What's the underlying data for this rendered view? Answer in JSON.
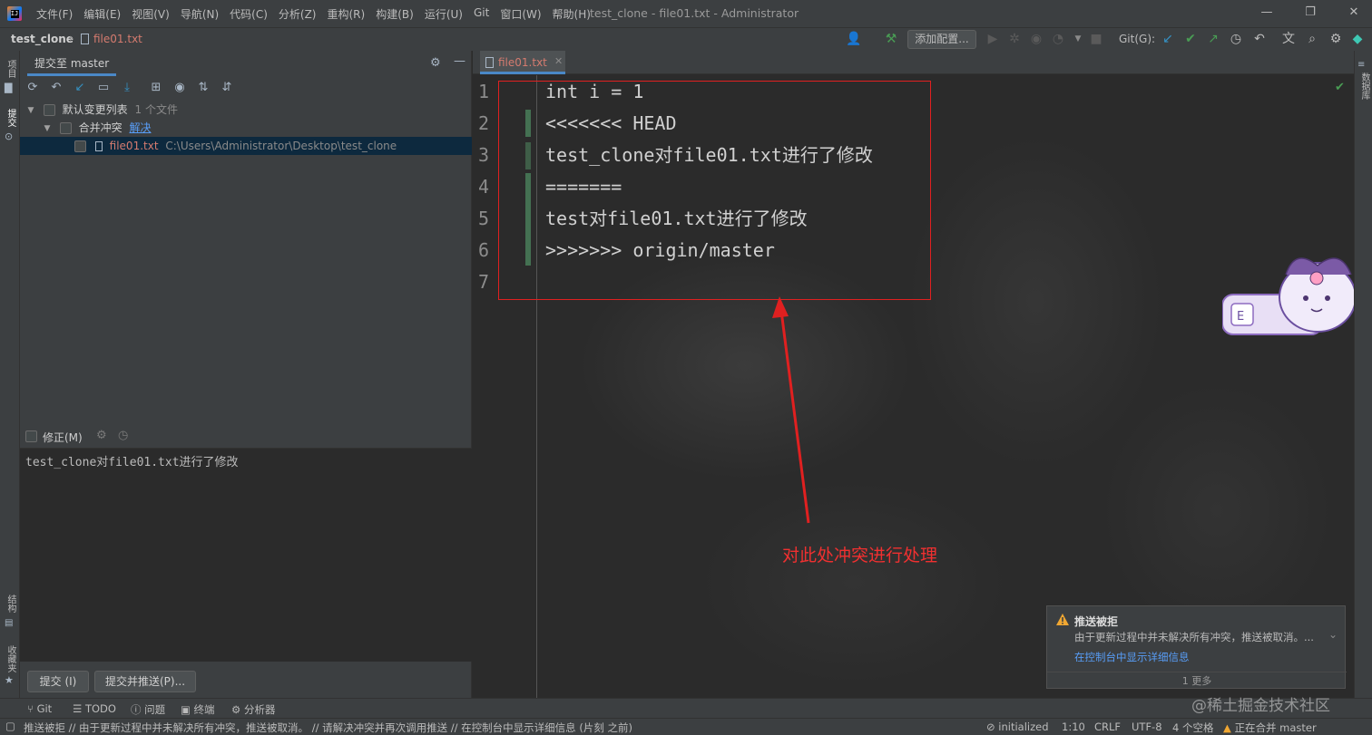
{
  "window": {
    "title": "test_clone - file01.txt - Administrator",
    "menu": [
      "文件(F)",
      "编辑(E)",
      "视图(V)",
      "导航(N)",
      "代码(C)",
      "分析(Z)",
      "重构(R)",
      "构建(B)",
      "运行(U)",
      "Git",
      "窗口(W)",
      "帮助(H)"
    ]
  },
  "navbar": {
    "project": "test_clone",
    "file": "file01.txt",
    "add_config": "添加配置...",
    "git_label": "Git(G):"
  },
  "left_strip": {
    "project_tab": "项目",
    "commit_tab": "提交",
    "structure_tab": "结构",
    "favorites_tab": "收藏夹"
  },
  "right_strip": {
    "database_tab": "数据库"
  },
  "commit_panel": {
    "tab_label": "提交至 master",
    "changelist_label": "默认变更列表",
    "changelist_count": "1 个文件",
    "merge_conflicts_label": "合并冲突",
    "resolve_link": "解决",
    "file_name": "file01.txt",
    "file_path": "C:\\Users\\Administrator\\Desktop\\test_clone",
    "amend_label": "修正(M)",
    "commit_message": "test_clone对file01.txt进行了修改",
    "commit_button": "提交 (I)",
    "commit_push_button": "提交并推送(P)..."
  },
  "editor": {
    "tab_label": "file01.txt",
    "lines": [
      {
        "no": "1",
        "text": "int i = 1"
      },
      {
        "no": "2",
        "text": "<<<<<<< HEAD"
      },
      {
        "no": "3",
        "text": "test_clone对file01.txt进行了修改"
      },
      {
        "no": "4",
        "text": "======="
      },
      {
        "no": "5",
        "text": "test对file01.txt进行了修改"
      },
      {
        "no": "6",
        "text": ">>>>>>> origin/master"
      },
      {
        "no": "7",
        "text": ""
      }
    ],
    "annotation": "对此处冲突进行处理",
    "highlight_color": "#e02020"
  },
  "notification": {
    "title": "推送被拒",
    "body": "由于更新过程中并未解决所有冲突，推送被取消。...",
    "link": "在控制台中显示详细信息",
    "more": "1 更多"
  },
  "tool_windows": [
    "Git",
    "TODO",
    "问题",
    "终端",
    "分析器"
  ],
  "statusbar": {
    "message": "推送被拒 // 由于更新过程中并未解决所有冲突，推送被取消。 // 请解决冲突并再次调用推送 // 在控制台中显示详细信息 (片刻 之前)",
    "vcs": "initialized",
    "position": "1:10",
    "line_sep": "CRLF",
    "encoding": "UTF-8",
    "indent": "4 个空格",
    "merge_status": "正在合并 master"
  },
  "watermark": "@稀土掘金技术社区",
  "colors": {
    "accent": "#4a88c7",
    "git_green": "#499c54",
    "git_blue": "#3592c4",
    "warning": "#f0a732"
  }
}
